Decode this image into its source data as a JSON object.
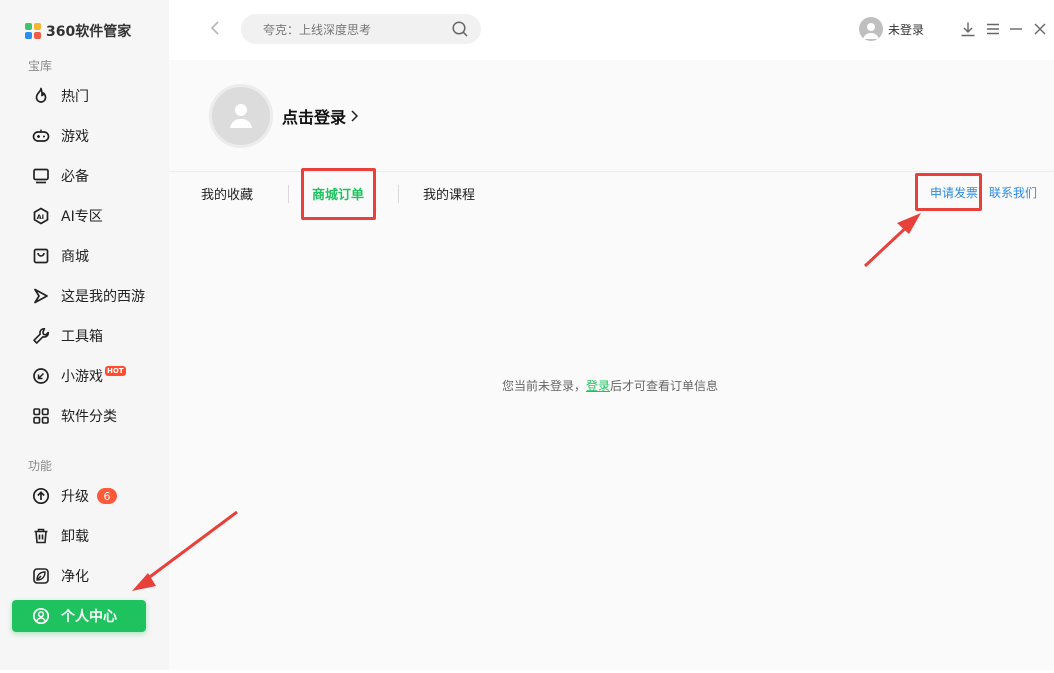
{
  "app": {
    "title": "360软件管家",
    "logo_colors": [
      "#3fc36b",
      "#f6b62d",
      "#2d8cf0",
      "#f05a47"
    ]
  },
  "sidebar": {
    "section_repo": "宝库",
    "section_func": "功能",
    "items": [
      {
        "label": "热门",
        "icon": "flame-icon"
      },
      {
        "label": "游戏",
        "icon": "gamepad-icon"
      },
      {
        "label": "必备",
        "icon": "monitor-icon"
      },
      {
        "label": "AI专区",
        "icon": "ai-icon"
      },
      {
        "label": "商城",
        "icon": "bag-icon"
      },
      {
        "label": "这是我的西游",
        "icon": "play-icon"
      },
      {
        "label": "工具箱",
        "icon": "wrench-icon"
      },
      {
        "label": "小游戏",
        "icon": "minigame-icon",
        "badge": "HOT"
      },
      {
        "label": "软件分类",
        "icon": "grid-icon"
      }
    ],
    "func_items": [
      {
        "label": "升级",
        "icon": "upgrade-icon",
        "count": "6"
      },
      {
        "label": "卸载",
        "icon": "trash-icon"
      },
      {
        "label": "净化",
        "icon": "leaf-icon"
      },
      {
        "label": "个人中心",
        "icon": "user-icon",
        "active": true
      }
    ],
    "accent": "#1ec35f"
  },
  "topbar": {
    "search_placeholder": "夸克：上线深度思考",
    "user_label": "未登录"
  },
  "main": {
    "login_prompt": "点击登录",
    "tabs": [
      "我的收藏",
      "商城订单",
      "我的课程"
    ],
    "active_tab": "商城订单",
    "right_links": [
      "申请发票",
      "联系我们"
    ],
    "empty_prefix": "您当前未登录，",
    "empty_link": "登录",
    "empty_suffix": "后才可查看订单信息"
  }
}
